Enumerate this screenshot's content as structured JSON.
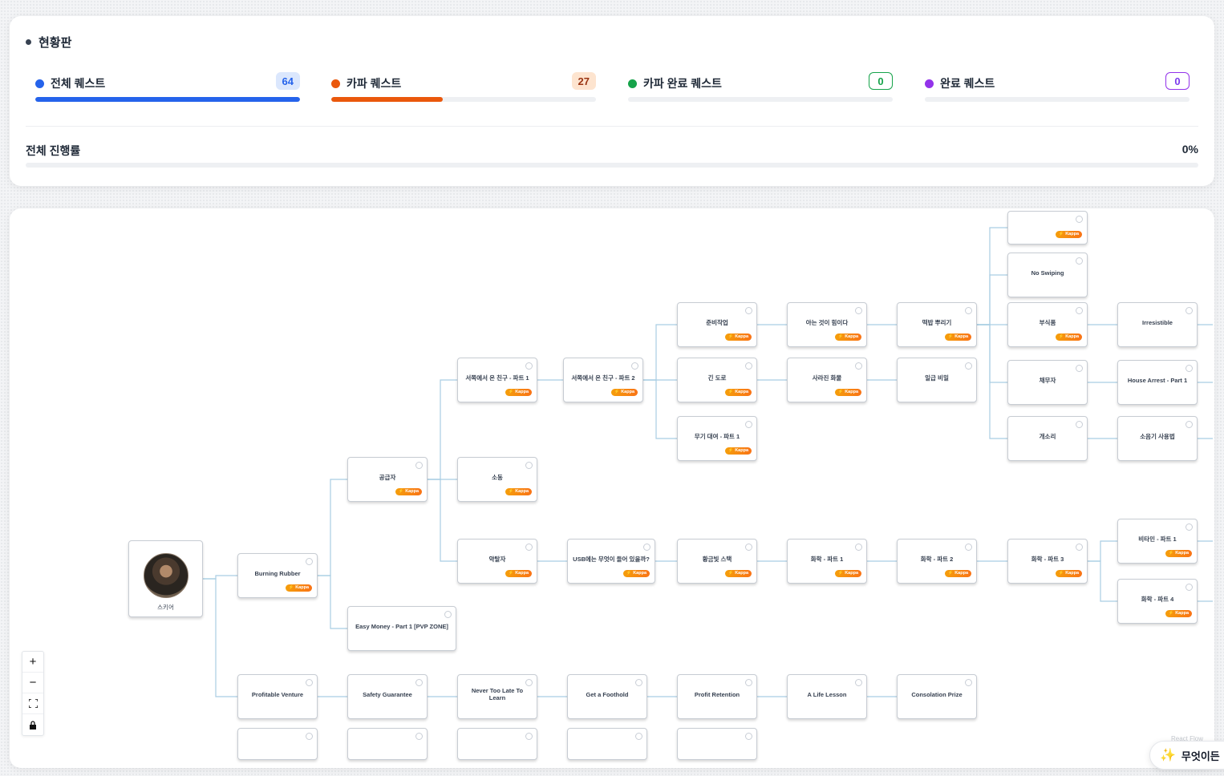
{
  "status": {
    "title": "현황판",
    "stats": [
      {
        "label": "전체 퀘스트",
        "count": "64",
        "color": "#2563eb",
        "badge_bg": "#dbe7fd",
        "badge_fg": "#2563eb",
        "progress": 1.0
      },
      {
        "label": "카파 퀘스트",
        "count": "27",
        "color": "#ea580c",
        "badge_bg": "#fde4cf",
        "badge_fg": "#9a3412",
        "progress": 0.42
      },
      {
        "label": "카파 완료 퀘스트",
        "count": "0",
        "color": "#16a34a",
        "badge_bg": "#ffffff",
        "badge_fg": "#16a34a",
        "progress": 0
      },
      {
        "label": "완료 퀘스트",
        "count": "0",
        "color": "#9333ea",
        "badge_bg": "#ffffff",
        "badge_fg": "#7c3aed",
        "progress": 0
      }
    ],
    "overall_label": "전체 진행률",
    "overall_value": "0%"
  },
  "flow": {
    "root_name": "스키어",
    "kappa_label": "⚡ Kappa",
    "nodes": [
      {
        "id": "n0",
        "title": "",
        "kappa": true
      },
      {
        "id": "n1",
        "title": "No Swiping",
        "kappa": false
      },
      {
        "id": "n2",
        "title": "준비작업",
        "kappa": true
      },
      {
        "id": "n3",
        "title": "아는 것이 힘이다",
        "kappa": true
      },
      {
        "id": "n4",
        "title": "떡밥 뿌리기",
        "kappa": true
      },
      {
        "id": "n5",
        "title": "부식품",
        "kappa": true
      },
      {
        "id": "n6",
        "title": "Irresistible",
        "kappa": false
      },
      {
        "id": "n7",
        "title": "서쪽에서 온 친구 - 파트 1",
        "kappa": true
      },
      {
        "id": "n8",
        "title": "서쪽에서 온 친구 - 파트 2",
        "kappa": true
      },
      {
        "id": "n9",
        "title": "긴 도로",
        "kappa": true
      },
      {
        "id": "n10",
        "title": "사라진 화물",
        "kappa": true
      },
      {
        "id": "n11",
        "title": "일급 비밀",
        "kappa": false
      },
      {
        "id": "n12",
        "title": "채무자",
        "kappa": false
      },
      {
        "id": "n13",
        "title": "House Arrest - Part 1",
        "kappa": false
      },
      {
        "id": "n14",
        "title": "무기 대여 - 파트 1",
        "kappa": true
      },
      {
        "id": "n15",
        "title": "개소리",
        "kappa": false
      },
      {
        "id": "n16",
        "title": "소음기 사용법",
        "kappa": false
      },
      {
        "id": "n17",
        "title": "공급자",
        "kappa": true
      },
      {
        "id": "n18",
        "title": "소동",
        "kappa": true
      },
      {
        "id": "n19",
        "title": "Burning Rubber",
        "kappa": true
      },
      {
        "id": "n20",
        "title": "약탈자",
        "kappa": true
      },
      {
        "id": "n21",
        "title": "USB에는 무엇이 들어 있을까?",
        "kappa": true
      },
      {
        "id": "n22",
        "title": "황금빛 스택",
        "kappa": true
      },
      {
        "id": "n23",
        "title": "화학 - 파트 1",
        "kappa": true
      },
      {
        "id": "n24",
        "title": "화학 - 파트 2",
        "kappa": true
      },
      {
        "id": "n25",
        "title": "화학 - 파트 3",
        "kappa": true
      },
      {
        "id": "n26",
        "title": "비타민 - 파트 1",
        "kappa": true
      },
      {
        "id": "n27",
        "title": "화학 - 파트 4",
        "kappa": true
      },
      {
        "id": "n28",
        "title": "Easy Money - Part 1 [PVP ZONE]",
        "kappa": false
      },
      {
        "id": "n29",
        "title": "Profitable Venture",
        "kappa": false
      },
      {
        "id": "n30",
        "title": "Safety Guarantee",
        "kappa": false
      },
      {
        "id": "n31",
        "title": "Never Too Late To Learn",
        "kappa": false
      },
      {
        "id": "n32",
        "title": "Get a Foothold",
        "kappa": false
      },
      {
        "id": "n33",
        "title": "Profit Retention",
        "kappa": false
      },
      {
        "id": "n34",
        "title": "A Life Lesson",
        "kappa": false
      },
      {
        "id": "n35",
        "title": "Consolation Prize",
        "kappa": false
      },
      {
        "id": "n36",
        "title": "",
        "kappa": false
      },
      {
        "id": "n37",
        "title": "",
        "kappa": false
      },
      {
        "id": "n38",
        "title": "",
        "kappa": false
      },
      {
        "id": "n39",
        "title": "",
        "kappa": false
      },
      {
        "id": "n40",
        "title": "",
        "kappa": false
      }
    ],
    "attribution": "React Flow"
  },
  "ask_button": "무엇이든"
}
